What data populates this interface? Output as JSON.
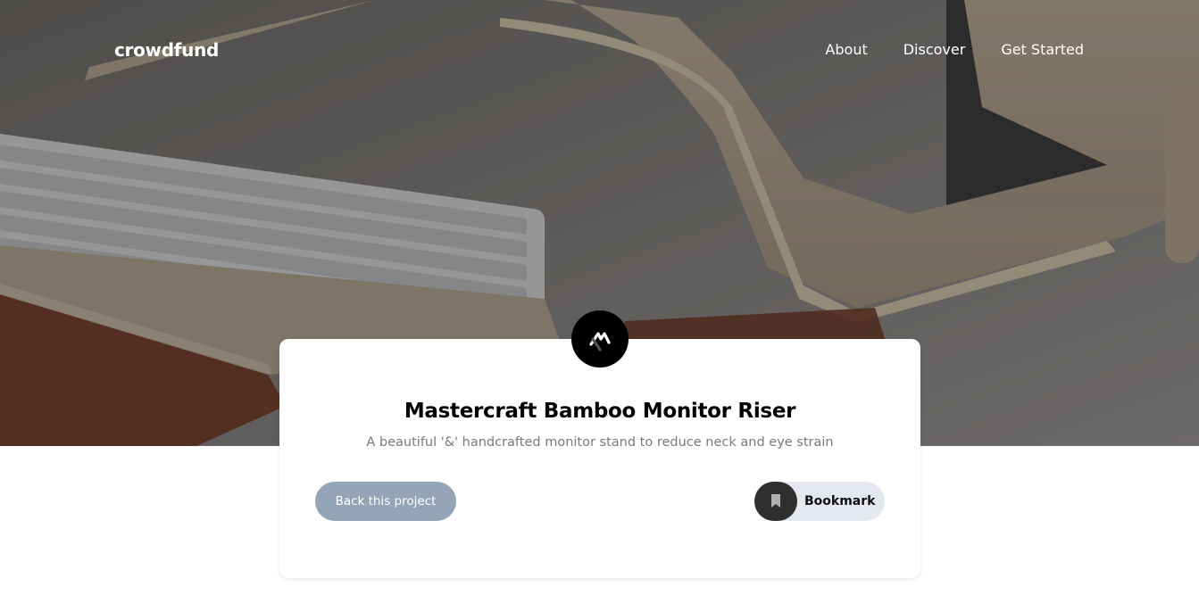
{
  "header": {
    "logo": "crowdfund",
    "nav": [
      {
        "label": "About"
      },
      {
        "label": "Discover"
      },
      {
        "label": "Get Started"
      }
    ]
  },
  "hero": {
    "image": "desk-with-keyboard-and-bamboo-monitor-riser",
    "overlay_color": "#000000"
  },
  "project": {
    "logo_icon": "mastercraft-logo-icon",
    "title": "Mastercraft Bamboo Monitor Riser",
    "description": "A beautiful '&' handcrafted monitor stand to reduce neck and eye strain",
    "back_label": "Back this project",
    "bookmark_label": "Bookmark",
    "bookmark_icon": "bookmark-icon"
  },
  "colors": {
    "back_button": "#95a5b8",
    "bookmark_pill": "#e5e8ee",
    "bookmark_circle": "#2f2f2f"
  }
}
